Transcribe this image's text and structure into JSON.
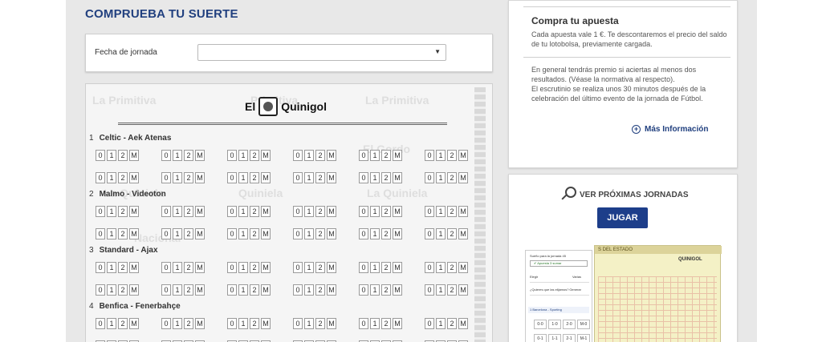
{
  "page_title": "COMPRUEBA TU SUERTE",
  "fecha": {
    "label": "Fecha de jornada",
    "selected": ""
  },
  "ticket": {
    "logo_left": "El",
    "logo_right": "Quinigol",
    "watermarks": [
      "La Primitiva",
      "Primitiva",
      "La Primitiva",
      "El Gordo",
      "La Quiniela",
      "Quiniela",
      "La Quiniela",
      "Nacional"
    ],
    "matches": [
      {
        "number": "1",
        "name": "Celtic - Aek Atenas"
      },
      {
        "number": "2",
        "name": "Malmo - Videoton"
      },
      {
        "number": "3",
        "name": "Standard - Ajax"
      },
      {
        "number": "4",
        "name": "Benfica - Fenerbahçe"
      }
    ],
    "options": [
      "0",
      "1",
      "2",
      "M"
    ],
    "groups_per_row": 6
  },
  "compra": {
    "title": "Compra tu apuesta",
    "text": "Cada apuesta vale 1 €. Te descontaremos el precio del saldo de tu lotobolsa, previamente cargada."
  },
  "premio": {
    "line1": "En general tendrás premio si aciertas al menos dos resultados. (Véase la normativa al respecto).",
    "line2": "El escrutinio se realiza unos 30 minutos después de la celebración del último evento de la jornada de Fútbol."
  },
  "mas_info": {
    "label": "Más Información",
    "icon": "plus-circle-icon"
  },
  "proximas": {
    "label": "VER PRÓXIMAS JORNADAS",
    "icon": "magnifier-icon"
  },
  "jugar": {
    "label": "JUGAR"
  },
  "preview": {
    "phone_title": "Sueño para la jornada 45",
    "phone_ok": "Apuesta 3 sumar",
    "phone_rows": [
      {
        "label": "Elegir",
        "value": "Varias"
      },
      {
        "label": "¿Quieres que las elijamos?",
        "value": "Generar"
      }
    ],
    "phone_match": "1 Barcelona - Sporting",
    "phone_cells": [
      "0-0",
      "1-0",
      "2-0",
      "M-0",
      "0-1",
      "1-1",
      "2-1",
      "M-1"
    ],
    "ticket_header": "S DEL ESTADO",
    "ticket_brand": "QUINIGOL"
  },
  "colors": {
    "title_blue": "#21407f",
    "button_blue": "#1d3e8a",
    "panel_gray": "#e8e8e8"
  }
}
